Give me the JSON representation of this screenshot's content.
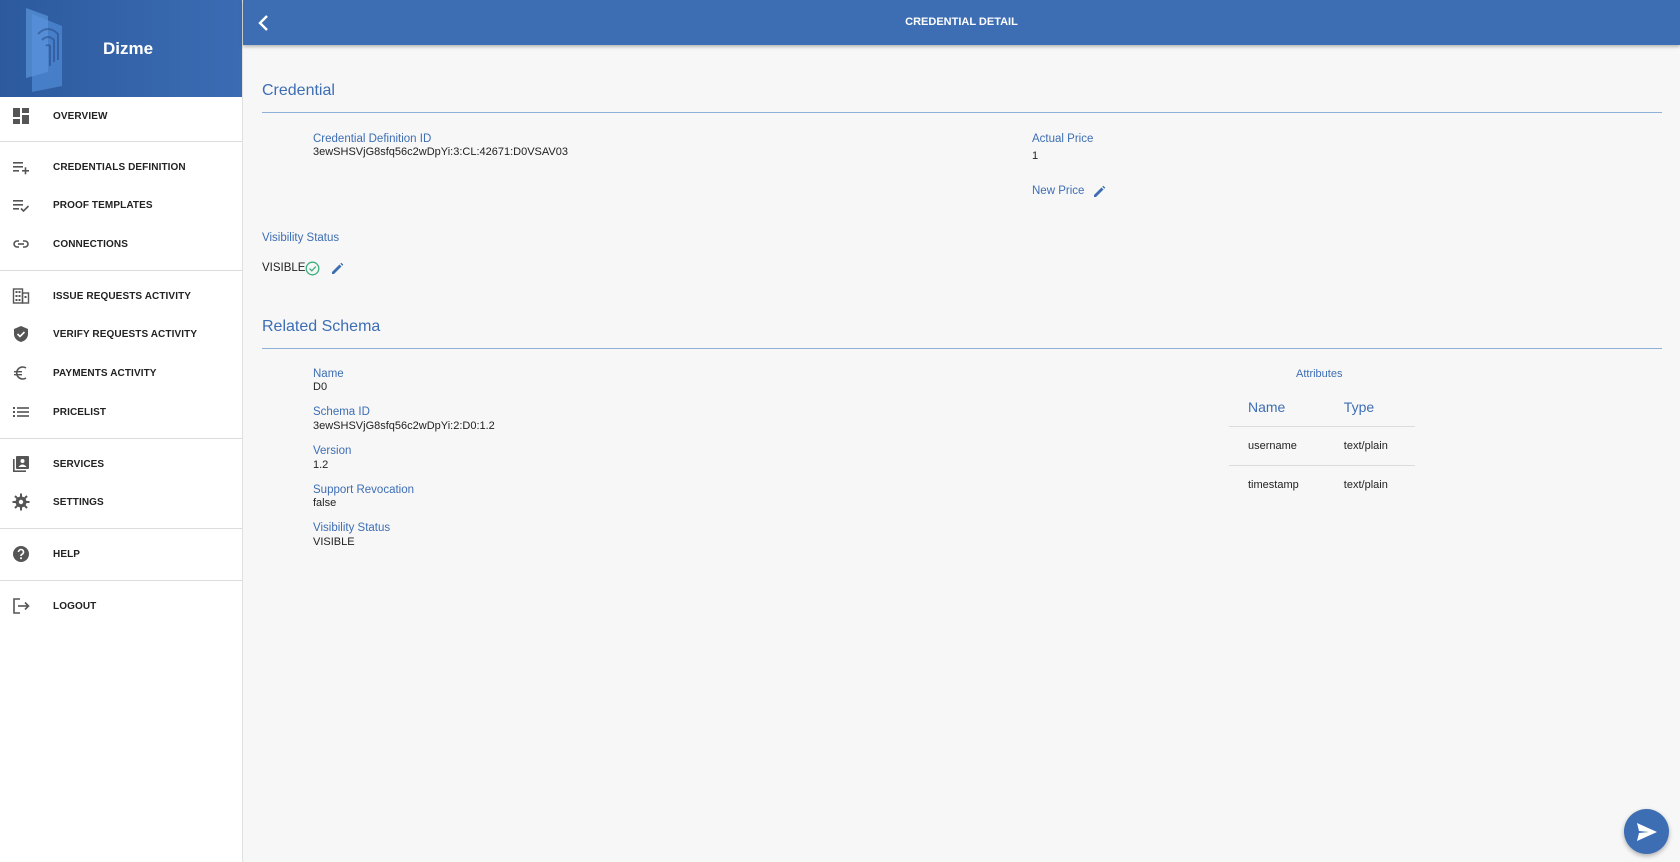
{
  "brand": {
    "title": "Dizme"
  },
  "sidebar": {
    "items": [
      {
        "label": "OVERVIEW",
        "icon": "dashboard-icon"
      },
      {
        "label": "CREDENTIALS DEFINITION",
        "icon": "playlist-add-icon"
      },
      {
        "label": "PROOF TEMPLATES",
        "icon": "playlist-check-icon"
      },
      {
        "label": "CONNECTIONS",
        "icon": "link-icon"
      },
      {
        "label": "ISSUE REQUESTS ACTIVITY",
        "icon": "building-icon"
      },
      {
        "label": "VERIFY REQUESTS ACTIVITY",
        "icon": "verified-shield-icon"
      },
      {
        "label": "PAYMENTS ACTIVITY",
        "icon": "euro-icon"
      },
      {
        "label": "PRICELIST",
        "icon": "list-icon"
      },
      {
        "label": "SERVICES",
        "icon": "library-books-icon"
      },
      {
        "label": "SETTINGS",
        "icon": "gear-icon"
      },
      {
        "label": "HELP",
        "icon": "help-circle-icon"
      },
      {
        "label": "LOGOUT",
        "icon": "logout-icon"
      }
    ]
  },
  "header": {
    "title": "CREDENTIAL DETAIL"
  },
  "credential": {
    "section_title": "Credential",
    "def_id_label": "Credential Definition ID",
    "def_id_value": "3ewSHSVjG8sfq56c2wDpYi:3:CL:42671:D0VSAV03",
    "actual_price_label": "Actual Price",
    "actual_price_value": "1",
    "new_price_label": "New Price",
    "visibility_label": "Visibility Status",
    "visibility_value": "VISIBLE"
  },
  "schema": {
    "section_title": "Related Schema",
    "name_label": "Name",
    "name_value": "D0",
    "schema_id_label": "Schema ID",
    "schema_id_value": "3ewSHSVjG8sfq56c2wDpYi:2:D0:1.2",
    "version_label": "Version",
    "version_value": "1.2",
    "revocation_label": "Support Revocation",
    "revocation_value": "false",
    "visibility_label": "Visibility Status",
    "visibility_value": "VISIBLE",
    "attributes_title": "Attributes",
    "attr_headers": {
      "name": "Name",
      "type": "Type"
    },
    "attributes": [
      {
        "name": "username",
        "type": "text/plain"
      },
      {
        "name": "timestamp",
        "type": "text/plain"
      }
    ]
  },
  "colors": {
    "primary": "#3d6eb4",
    "check": "#3cae7a"
  }
}
